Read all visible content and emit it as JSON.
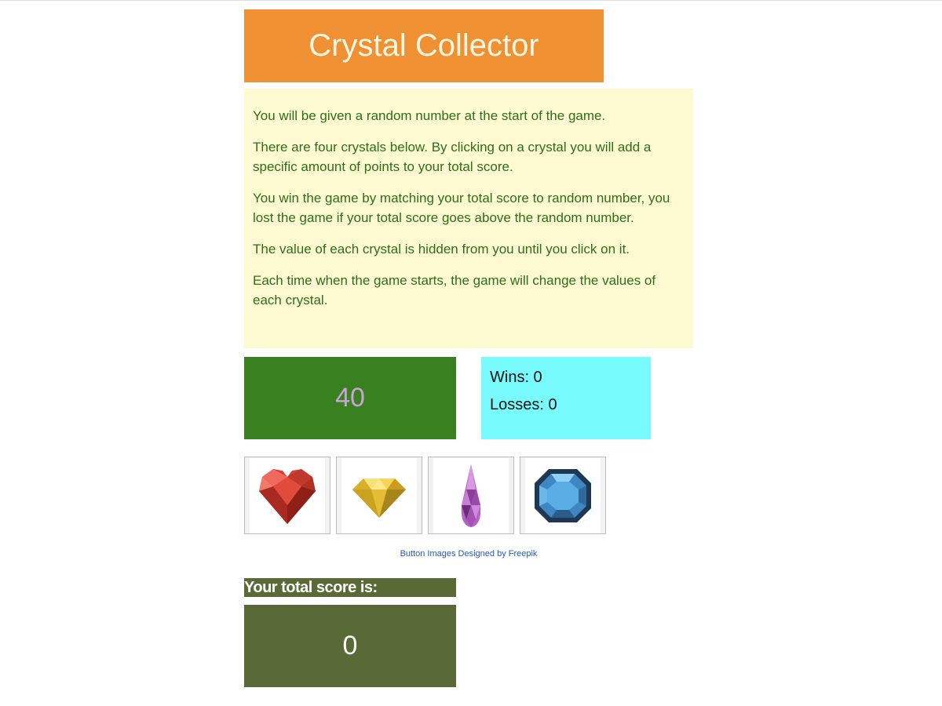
{
  "title": "Crystal Collector",
  "instructions": [
    "You will be given a random number at the start of the game.",
    "There are four crystals below. By clicking on a crystal you will add a specific amount of points to your total score.",
    "You win the game by matching your total score to random number, you lost the game if your total score goes above the random number.",
    "The value of each crystal is hidden from you until you click on it.",
    "Each time when the game starts, the game will change the values of each crystal."
  ],
  "target_number": "40",
  "stats": {
    "wins_label": "Wins: 0",
    "losses_label": "Losses: 0"
  },
  "crystals": [
    {
      "icon": "red-heart-gem-icon"
    },
    {
      "icon": "yellow-diamond-gem-icon"
    },
    {
      "icon": "purple-drop-gem-icon"
    },
    {
      "icon": "blue-octagon-gem-icon"
    }
  ],
  "credit_link": "Button Images Designed by Freepik",
  "score": {
    "label": "Your total score is:",
    "value": "0"
  },
  "colors": {
    "title_bg": "#ef9133",
    "instructions_bg": "#fdfad2",
    "instructions_text": "#2d6e1c",
    "target_bg": "#398020",
    "target_text": "#c9a4d6",
    "stats_bg": "#78fbfc",
    "score_bg": "#5a6a36"
  }
}
